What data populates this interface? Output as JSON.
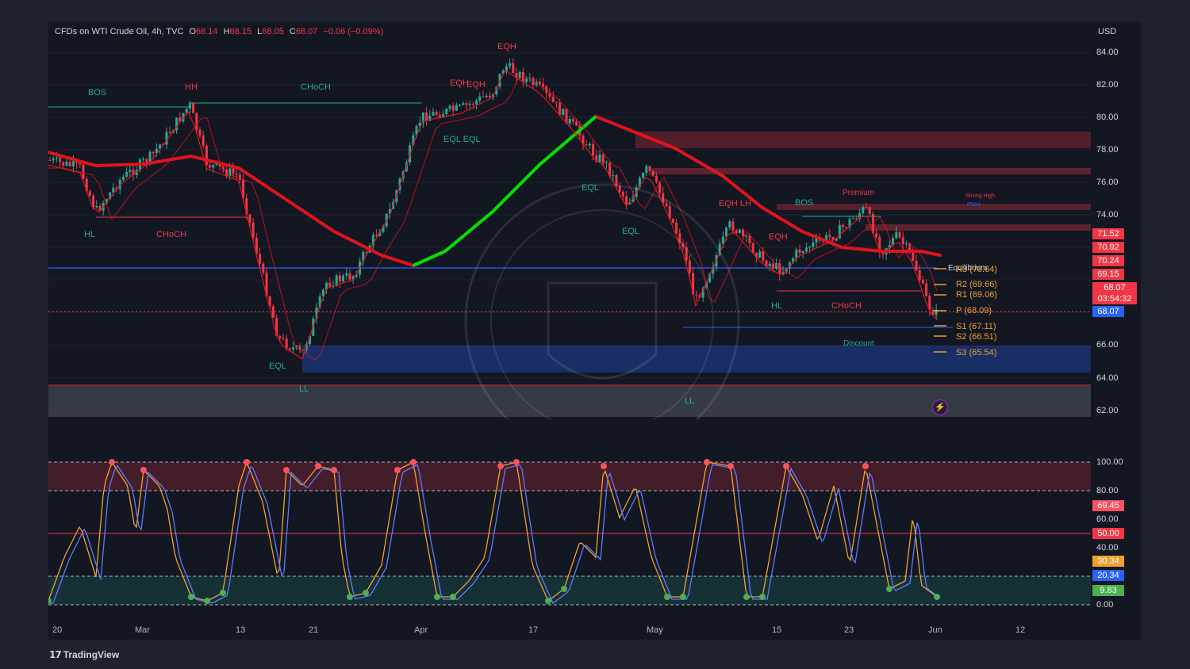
{
  "header": {
    "symbol": "CFDs on WTI Crude Oil, 4h, TVC",
    "open_label": "O",
    "open": "68.14",
    "high_label": "H",
    "high": "68.15",
    "low_label": "L",
    "low": "68.05",
    "close_label": "C",
    "close": "68.07",
    "change": "−0.06 (−0.09%)"
  },
  "axis": {
    "currency": "USD",
    "price_ticks": [
      "84.00",
      "82.00",
      "80.00",
      "78.00",
      "76.00",
      "74.00",
      "66.00",
      "64.00",
      "62.00"
    ],
    "osc_ticks": [
      "100.00",
      "80.00",
      "60.00",
      "40.00",
      "0.00"
    ],
    "time_ticks": [
      "20",
      "Mar",
      "13",
      "21",
      "Apr",
      "17",
      "May",
      "15",
      "23",
      "Jun",
      "12"
    ]
  },
  "price_badges": [
    {
      "label": "71.52",
      "color": "#f23645"
    },
    {
      "label": "70.92",
      "color": "#f23645"
    },
    {
      "label": "70.24",
      "color": "#f23645"
    },
    {
      "label": "69.15",
      "color": "#f23645"
    },
    {
      "label": "68.07",
      "color": "#f23645"
    },
    {
      "label": "03:54:32",
      "color": "#f23645"
    },
    {
      "label": "68.07",
      "color": "#2962ff"
    }
  ],
  "osc_badges": [
    {
      "label": "69.45",
      "color": "#f7525f"
    },
    {
      "label": "50.00",
      "color": "#f23645"
    },
    {
      "label": "30.34",
      "color": "#f0a030"
    },
    {
      "label": "20.34",
      "color": "#2962ff"
    },
    {
      "label": "9.83",
      "color": "#4caf50"
    }
  ],
  "pivots": [
    "R3 (70.64)",
    "R2 (69.66)",
    "R1 (69.06)",
    "P (68.09)",
    "S1 (67.11)",
    "S2 (66.51)",
    "S3 (65.54)"
  ],
  "structure_labels": {
    "bos_1": "BOS",
    "hh": "HH",
    "choch_1": "CHoCH",
    "hl_1": "HL",
    "choch_2": "CHoCH",
    "eql_1": "EQL",
    "ll_1": "LL",
    "eqh_1": "EQH",
    "eqh_2": "EQH",
    "eqh_top": "EQH",
    "eql_2": "EQL EQL",
    "eql_3": "EQL",
    "eql_4": "EQL",
    "ll_2": "LL",
    "eqh_lh": "EQH LH",
    "bos_2": "BOS",
    "premium": "Premium",
    "eqh_3": "EQH",
    "hl_2": "HL",
    "choch_3": "CHoCH",
    "discount": "Discount",
    "equilibrium": "Equilibrium",
    "strong_high": "Strong High",
    "pwh": "PWH"
  },
  "branding": {
    "logo": "TradingView",
    "lightning": "⚡"
  },
  "colors": {
    "bull": "#22ab94",
    "bear": "#f23645",
    "ema_green": "#00e000",
    "ema_red": "#e0141e",
    "blue": "#2962ff",
    "orange": "#f0a030"
  }
}
